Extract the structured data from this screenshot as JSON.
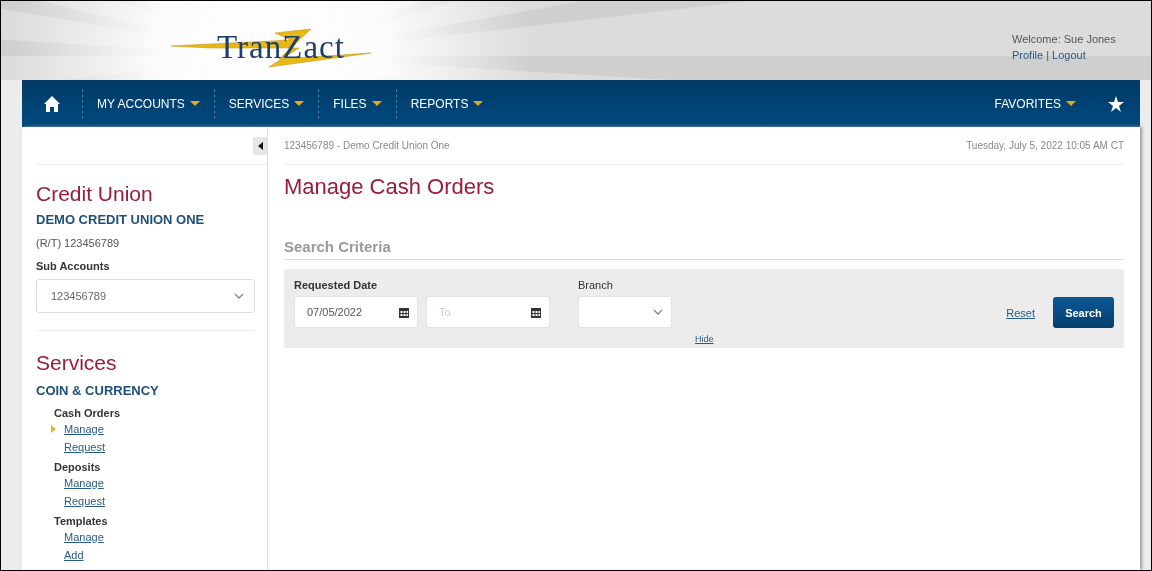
{
  "header": {
    "logo": "TranZact",
    "welcome": "Welcome: Sue Jones",
    "links": [
      {
        "label": "Profile"
      },
      {
        "label": "Logout"
      }
    ],
    "link_separator": "|"
  },
  "nav": {
    "items": [
      {
        "label": "MY ACCOUNTS",
        "dropdown": true
      },
      {
        "label": "SERVICES",
        "dropdown": true
      },
      {
        "label": "FILES",
        "dropdown": true
      },
      {
        "label": "REPORTS",
        "dropdown": true
      }
    ],
    "favorites": {
      "label": "FAVORITES",
      "dropdown": true
    }
  },
  "sidebar": {
    "credit_union": {
      "heading": "Credit Union",
      "name": "DEMO CREDIT UNION ONE",
      "routing": "(R/T) 123456789",
      "sub_accounts_label": "Sub Accounts",
      "sub_account": "123456789"
    },
    "services": {
      "heading": "Services",
      "category": "COIN & CURRENCY",
      "groups": [
        {
          "label": "Cash Orders",
          "children": [
            {
              "label": "Manage",
              "selected": true
            },
            {
              "label": "Request",
              "selected": false
            }
          ]
        },
        {
          "label": "Deposits",
          "children": [
            {
              "label": "Manage",
              "selected": false
            },
            {
              "label": "Request",
              "selected": false
            }
          ]
        },
        {
          "label": "Templates",
          "children": [
            {
              "label": "Manage",
              "selected": false
            },
            {
              "label": "Add",
              "selected": false
            }
          ]
        }
      ]
    }
  },
  "main": {
    "breadcrumb": "123456789 - Demo Credit Union One",
    "datetime": "Tuesday, July 5, 2022 10:05 AM CT",
    "title": "Manage Cash Orders",
    "search_criteria": {
      "heading": "Search Criteria",
      "requested_date_label": "Requested Date",
      "from_date": "07/05/2022",
      "to_placeholder": "To",
      "branch_label": "Branch",
      "hide_link": "Hide",
      "reset_link": "Reset",
      "search_button": "Search"
    }
  }
}
